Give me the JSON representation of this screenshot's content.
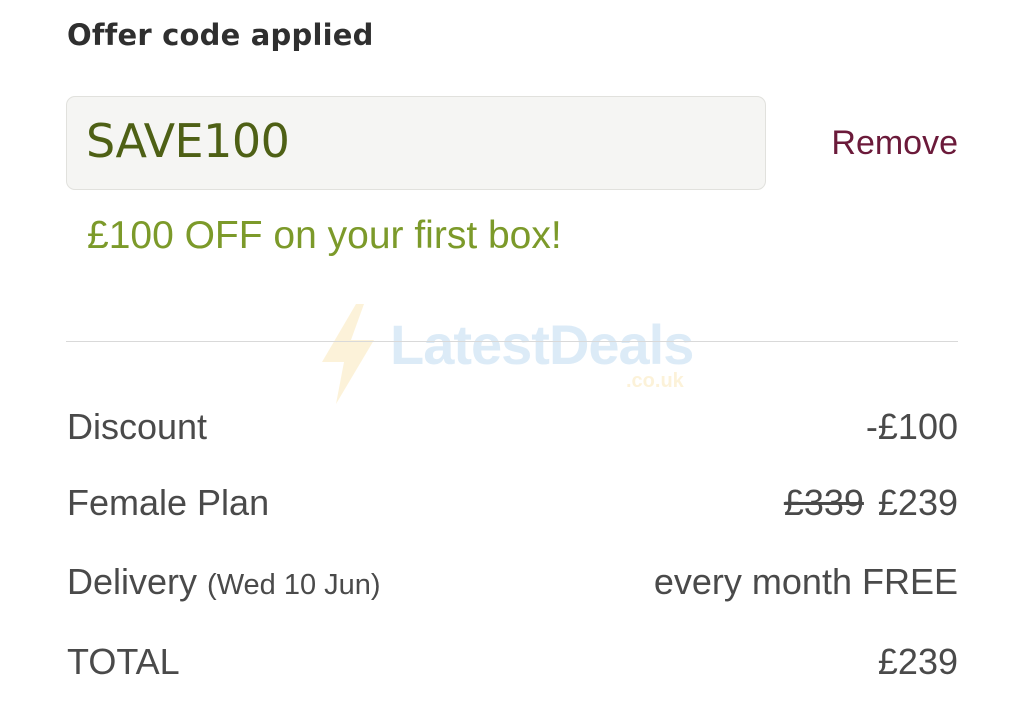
{
  "offer": {
    "heading": "Offer code applied",
    "code": "SAVE100",
    "remove_label": "Remove",
    "note": "£100 OFF on your first box!"
  },
  "watermark": {
    "text": "LatestDeals",
    "sub": ".co.uk",
    "icon": "lightning-bolt-icon"
  },
  "summary": {
    "discount": {
      "label": "Discount",
      "value": "-£100"
    },
    "plan": {
      "label": "Female Plan",
      "old_price": "£339",
      "price": "£239"
    },
    "delivery": {
      "label": "Delivery",
      "date": "(Wed 10 Jun)",
      "value": "every month FREE"
    },
    "total": {
      "label": "TOTAL",
      "value": "£239"
    }
  },
  "colors": {
    "code_text": "#4e6015",
    "remove_link": "#6b1a3a",
    "offer_note": "#7c9a2a",
    "body_text": "#4a4a4a"
  }
}
